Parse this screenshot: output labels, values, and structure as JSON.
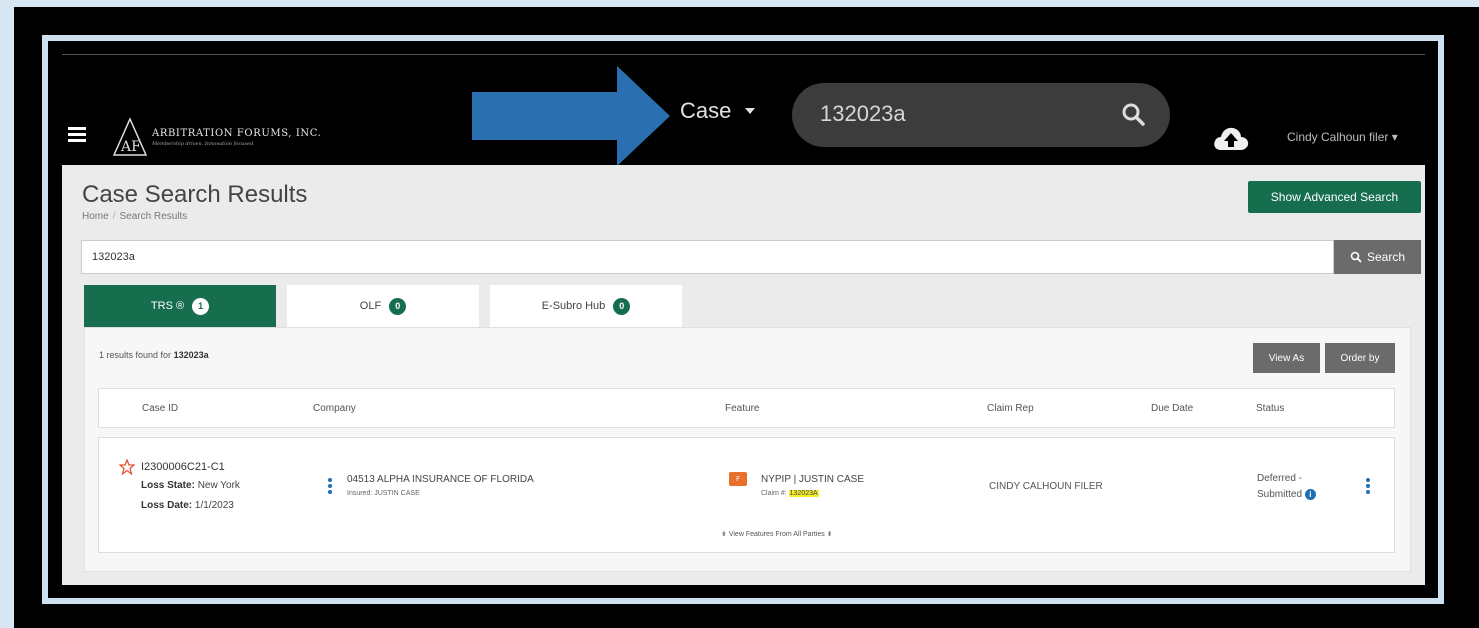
{
  "header": {
    "logo_title": "ARBITRATION FORUMS, INC.",
    "logo_subtitle": "Membership driven. Innovation focused.",
    "search_scope": "Case",
    "search_value": "132023a",
    "user_name": "Cindy Calhoun filer"
  },
  "page": {
    "title": "Case Search Results",
    "breadcrumb": [
      "Home",
      "Search Results"
    ],
    "advanced_search_label": "Show Advanced Search",
    "search_value": "132023a",
    "search_button_label": "Search"
  },
  "tabs": [
    {
      "label": "TRS ®",
      "count": "1",
      "active": true
    },
    {
      "label": "OLF",
      "count": "0",
      "active": false
    },
    {
      "label": "E-Subro Hub",
      "count": "0",
      "active": false
    }
  ],
  "results": {
    "summary_prefix": "1 results found for",
    "summary_query": "132023a",
    "view_as_label": "View As",
    "order_by_label": "Order by",
    "columns": [
      "Case ID",
      "Company",
      "Feature",
      "Claim Rep",
      "Due Date",
      "Status"
    ],
    "rows": [
      {
        "case_id": "I2300006C21-C1",
        "loss_state_label": "Loss State:",
        "loss_state": "New York",
        "loss_date_label": "Loss Date:",
        "loss_date": "1/1/2023",
        "company": "04513 ALPHA INSURANCE OF FLORIDA",
        "insured": "Insured: JUSTIN CASE",
        "feature_badge": "F",
        "feature": "NYPIP | JUSTIN CASE",
        "claim_label": "Claim #:",
        "claim_number": "132023A",
        "view_features": "View Features From All Parties",
        "claim_rep": "CINDY CALHOUN FILER",
        "due_date": "",
        "status_line1": "Deferred -",
        "status_line2": "Submitted"
      }
    ]
  },
  "colors": {
    "brand_green": "#166e4f",
    "arrow_blue": "#2a6fb0",
    "highlight": "#f5ee2d",
    "feature_orange": "#e8702a"
  }
}
